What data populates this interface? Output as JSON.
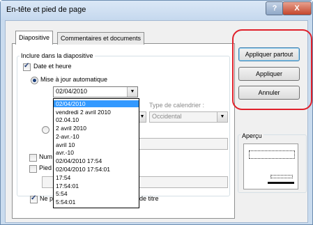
{
  "window": {
    "title": "En-tête et pied de page",
    "help_label": "?",
    "close_label": "X"
  },
  "tabs": [
    {
      "label": "Diapositive"
    },
    {
      "label": "Commentaires et documents"
    }
  ],
  "include_group": {
    "label": "Inclure dans la diapositive",
    "date_time": {
      "label": "Date et heure",
      "checked": true
    },
    "auto_update": {
      "label": "Mise à jour automatique",
      "selected": true
    },
    "date_format_value": "02/04/2010",
    "calendar_type": {
      "label": "Type de calendrier :",
      "value": "Occidental"
    },
    "slide_number_label": "Num",
    "footer_label": "Pied",
    "no_title_slide_label_start": "Ne p",
    "no_title_slide_label_end": "de titre"
  },
  "dropdown_options": [
    "02/04/2010",
    "vendredi 2 avril 2010",
    "02.04.10",
    "2 avril 2010",
    "2-avr.-10",
    "avril 10",
    "avr.-10",
    "02/04/2010 17:54",
    "02/04/2010 17:54:01",
    "17:54",
    "17:54:01",
    "5:54",
    "5:54:01"
  ],
  "buttons": {
    "apply_all": "Appliquer partout",
    "apply": "Appliquer",
    "cancel": "Annuler"
  },
  "preview": {
    "label": "Aperçu"
  },
  "colors": {
    "highlight": "#e0202a",
    "selection": "#3399ff",
    "title_bar": "#c9dbee"
  }
}
